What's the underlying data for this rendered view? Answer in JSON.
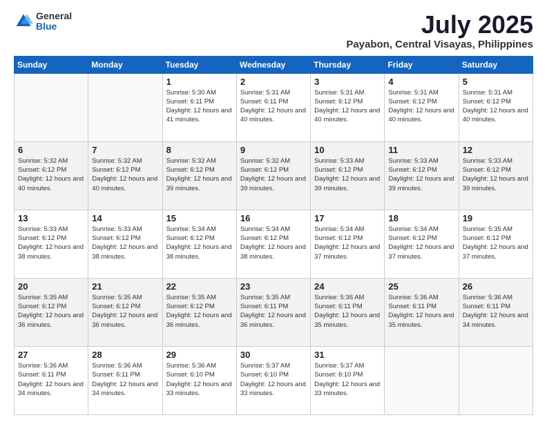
{
  "logo": {
    "general": "General",
    "blue": "Blue"
  },
  "header": {
    "month": "July 2025",
    "location": "Payabon, Central Visayas, Philippines"
  },
  "days_of_week": [
    "Sunday",
    "Monday",
    "Tuesday",
    "Wednesday",
    "Thursday",
    "Friday",
    "Saturday"
  ],
  "weeks": [
    {
      "shaded": false,
      "days": [
        {
          "num": "",
          "info": ""
        },
        {
          "num": "",
          "info": ""
        },
        {
          "num": "1",
          "info": "Sunrise: 5:30 AM\nSunset: 6:11 PM\nDaylight: 12 hours and 41 minutes."
        },
        {
          "num": "2",
          "info": "Sunrise: 5:31 AM\nSunset: 6:11 PM\nDaylight: 12 hours and 40 minutes."
        },
        {
          "num": "3",
          "info": "Sunrise: 5:31 AM\nSunset: 6:12 PM\nDaylight: 12 hours and 40 minutes."
        },
        {
          "num": "4",
          "info": "Sunrise: 5:31 AM\nSunset: 6:12 PM\nDaylight: 12 hours and 40 minutes."
        },
        {
          "num": "5",
          "info": "Sunrise: 5:31 AM\nSunset: 6:12 PM\nDaylight: 12 hours and 40 minutes."
        }
      ]
    },
    {
      "shaded": true,
      "days": [
        {
          "num": "6",
          "info": "Sunrise: 5:32 AM\nSunset: 6:12 PM\nDaylight: 12 hours and 40 minutes."
        },
        {
          "num": "7",
          "info": "Sunrise: 5:32 AM\nSunset: 6:12 PM\nDaylight: 12 hours and 40 minutes."
        },
        {
          "num": "8",
          "info": "Sunrise: 5:32 AM\nSunset: 6:12 PM\nDaylight: 12 hours and 39 minutes."
        },
        {
          "num": "9",
          "info": "Sunrise: 5:32 AM\nSunset: 6:12 PM\nDaylight: 12 hours and 39 minutes."
        },
        {
          "num": "10",
          "info": "Sunrise: 5:33 AM\nSunset: 6:12 PM\nDaylight: 12 hours and 39 minutes."
        },
        {
          "num": "11",
          "info": "Sunrise: 5:33 AM\nSunset: 6:12 PM\nDaylight: 12 hours and 39 minutes."
        },
        {
          "num": "12",
          "info": "Sunrise: 5:33 AM\nSunset: 6:12 PM\nDaylight: 12 hours and 39 minutes."
        }
      ]
    },
    {
      "shaded": false,
      "days": [
        {
          "num": "13",
          "info": "Sunrise: 5:33 AM\nSunset: 6:12 PM\nDaylight: 12 hours and 38 minutes."
        },
        {
          "num": "14",
          "info": "Sunrise: 5:33 AM\nSunset: 6:12 PM\nDaylight: 12 hours and 38 minutes."
        },
        {
          "num": "15",
          "info": "Sunrise: 5:34 AM\nSunset: 6:12 PM\nDaylight: 12 hours and 38 minutes."
        },
        {
          "num": "16",
          "info": "Sunrise: 5:34 AM\nSunset: 6:12 PM\nDaylight: 12 hours and 38 minutes."
        },
        {
          "num": "17",
          "info": "Sunrise: 5:34 AM\nSunset: 6:12 PM\nDaylight: 12 hours and 37 minutes."
        },
        {
          "num": "18",
          "info": "Sunrise: 5:34 AM\nSunset: 6:12 PM\nDaylight: 12 hours and 37 minutes."
        },
        {
          "num": "19",
          "info": "Sunrise: 5:35 AM\nSunset: 6:12 PM\nDaylight: 12 hours and 37 minutes."
        }
      ]
    },
    {
      "shaded": true,
      "days": [
        {
          "num": "20",
          "info": "Sunrise: 5:35 AM\nSunset: 6:12 PM\nDaylight: 12 hours and 36 minutes."
        },
        {
          "num": "21",
          "info": "Sunrise: 5:35 AM\nSunset: 6:12 PM\nDaylight: 12 hours and 36 minutes."
        },
        {
          "num": "22",
          "info": "Sunrise: 5:35 AM\nSunset: 6:12 PM\nDaylight: 12 hours and 36 minutes."
        },
        {
          "num": "23",
          "info": "Sunrise: 5:35 AM\nSunset: 6:11 PM\nDaylight: 12 hours and 36 minutes."
        },
        {
          "num": "24",
          "info": "Sunrise: 5:36 AM\nSunset: 6:11 PM\nDaylight: 12 hours and 35 minutes."
        },
        {
          "num": "25",
          "info": "Sunrise: 5:36 AM\nSunset: 6:11 PM\nDaylight: 12 hours and 35 minutes."
        },
        {
          "num": "26",
          "info": "Sunrise: 5:36 AM\nSunset: 6:11 PM\nDaylight: 12 hours and 34 minutes."
        }
      ]
    },
    {
      "shaded": false,
      "days": [
        {
          "num": "27",
          "info": "Sunrise: 5:36 AM\nSunset: 6:11 PM\nDaylight: 12 hours and 34 minutes."
        },
        {
          "num": "28",
          "info": "Sunrise: 5:36 AM\nSunset: 6:11 PM\nDaylight: 12 hours and 34 minutes."
        },
        {
          "num": "29",
          "info": "Sunrise: 5:36 AM\nSunset: 6:10 PM\nDaylight: 12 hours and 33 minutes."
        },
        {
          "num": "30",
          "info": "Sunrise: 5:37 AM\nSunset: 6:10 PM\nDaylight: 12 hours and 33 minutes."
        },
        {
          "num": "31",
          "info": "Sunrise: 5:37 AM\nSunset: 6:10 PM\nDaylight: 12 hours and 33 minutes."
        },
        {
          "num": "",
          "info": ""
        },
        {
          "num": "",
          "info": ""
        }
      ]
    }
  ]
}
